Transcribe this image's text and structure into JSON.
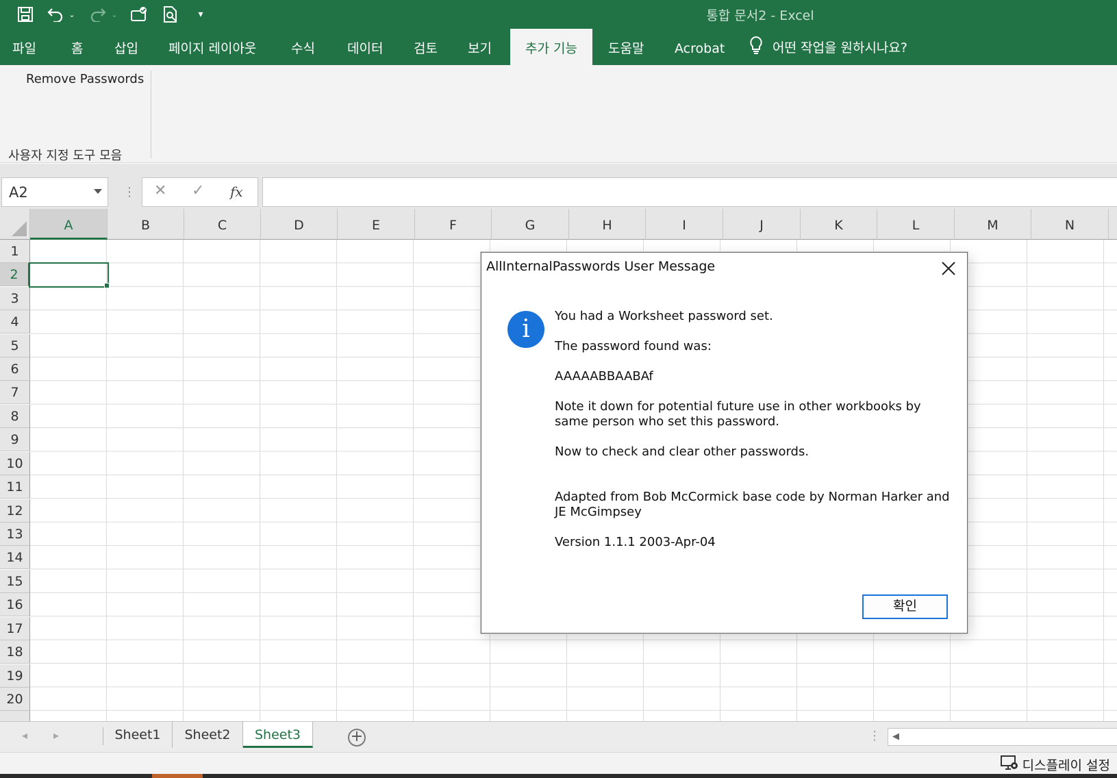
{
  "window": {
    "title": "통합 문서2  -  Excel"
  },
  "quick_access": {
    "icons": [
      "save-icon",
      "undo-icon",
      "redo-icon",
      "touch-mode-icon",
      "print-preview-icon",
      "customize-qat-icon"
    ]
  },
  "ribbon": {
    "tabs": [
      {
        "label": "파일"
      },
      {
        "label": "홈"
      },
      {
        "label": "삽입"
      },
      {
        "label": "페이지 레이아웃"
      },
      {
        "label": "수식"
      },
      {
        "label": "데이터"
      },
      {
        "label": "검토"
      },
      {
        "label": "보기"
      },
      {
        "label": "추가 기능"
      },
      {
        "label": "도움말"
      },
      {
        "label": "Acrobat"
      }
    ],
    "active_tab": "추가 기능",
    "tell_me": "어떤 작업을 원하시나요?",
    "remove_passwords": "Remove Passwords",
    "group_label": "사용자 지정 도구 모음"
  },
  "formula_bar": {
    "name_box": "A2",
    "fx": "fx",
    "cancel": "✕",
    "enter": "✓",
    "value": ""
  },
  "grid": {
    "columns": [
      "A",
      "B",
      "C",
      "D",
      "E",
      "F",
      "G",
      "H",
      "I",
      "J",
      "K",
      "L",
      "M",
      "N"
    ],
    "rows": [
      "1",
      "2",
      "3",
      "4",
      "5",
      "6",
      "7",
      "8",
      "9",
      "10",
      "11",
      "12",
      "13",
      "14",
      "15",
      "16",
      "17",
      "18",
      "19",
      "20"
    ],
    "selected_cell": "A2"
  },
  "sheets": {
    "tabs": [
      {
        "label": "Sheet1"
      },
      {
        "label": "Sheet2"
      },
      {
        "label": "Sheet3"
      }
    ],
    "active": "Sheet3"
  },
  "status_bar": {
    "display_settings": "디스플레이 설정"
  },
  "dialog": {
    "title": "AllInternalPasswords User Message",
    "lines": [
      "You had a Worksheet password set.",
      "The password found was:",
      "AAAAABBAABAf",
      "Note it down for potential future use in other workbooks by same person who set this password.",
      "Now to check and clear other passwords.",
      "Adapted from Bob McCormick base code by Norman Harker and JE McGimpsey",
      "Version 1.1.1 2003-Apr-04"
    ],
    "ok_label": "확인"
  },
  "colors": {
    "excel_green": "#217346",
    "dialog_accent": "#1a73d9"
  }
}
